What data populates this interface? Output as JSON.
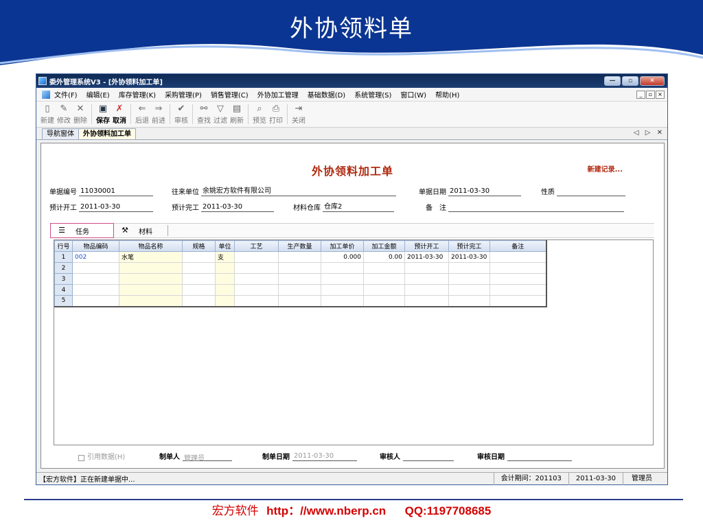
{
  "slide": {
    "title": "外协领料单",
    "footer_brand": "宏方软件",
    "footer_url": "http：//www.nberp.cn",
    "footer_qq": "QQ:1197708685",
    "colors": {
      "header_blue": "#0a2f86",
      "footer_red": "#d40000"
    }
  },
  "window": {
    "title": "委外管理系统V3 - [外协领料加工单]",
    "buttons": {
      "minimize": "—",
      "restore": "▫",
      "close": "✕"
    }
  },
  "menu": {
    "items": [
      "文件(F)",
      "编辑(E)",
      "库存管理(K)",
      "采购管理(P)",
      "销售管理(C)",
      "外协加工管理",
      "基础数据(D)",
      "系统管理(S)",
      "窗口(W)",
      "帮助(H)"
    ],
    "mdi_buttons": [
      "_",
      "▫",
      "×"
    ]
  },
  "toolbar": {
    "new": "新建",
    "edit": "修改",
    "delete": "删除",
    "save": "保存",
    "cancel": "取消",
    "back": "后退",
    "forward": "前进",
    "audit": "审核",
    "find": "查找",
    "filter": "过滤",
    "refresh": "刷新",
    "preview": "预览",
    "print": "打印",
    "close": "关闭"
  },
  "tabs": {
    "nav": "导航窗体",
    "active": "外协领料加工单",
    "nav_arrows": "◁ ▷ ✕"
  },
  "form": {
    "title": "外协领料加工单",
    "status": "新建记录...",
    "bill_no_label": "单据编号",
    "bill_no": "11030001",
    "partner_label": "往来单位",
    "partner": "余姚宏方软件有限公司",
    "bill_date_label": "单据日期",
    "bill_date": "2011-03-30",
    "nature_label": "性质",
    "nature": "",
    "plan_start_label": "预计开工",
    "plan_start": "2011-03-30",
    "plan_end_label": "预计完工",
    "plan_end": "2011-03-30",
    "warehouse_label": "材料仓库",
    "warehouse": "仓库2",
    "note_label": "备　注",
    "note": ""
  },
  "sub_tabs": {
    "task": "任务",
    "material": "材料"
  },
  "grid": {
    "headers": [
      "行号",
      "物品编码",
      "物品名称",
      "规格",
      "单位",
      "工艺",
      "生产数量",
      "加工单价",
      "加工金额",
      "预计开工",
      "预计完工",
      "备注"
    ],
    "rows": [
      [
        "1",
        "002",
        "水笔",
        "",
        "支",
        "",
        "",
        "0.000",
        "0.00",
        "2011-03-30",
        "2011-03-30",
        ""
      ],
      [
        "2",
        "",
        "",
        "",
        "",
        "",
        "",
        "",
        "",
        "",
        "",
        ""
      ],
      [
        "3",
        "",
        "",
        "",
        "",
        "",
        "",
        "",
        "",
        "",
        "",
        ""
      ],
      [
        "4",
        "",
        "",
        "",
        "",
        "",
        "",
        "",
        "",
        "",
        "",
        ""
      ],
      [
        "5",
        "",
        "",
        "",
        "",
        "",
        "",
        "",
        "",
        "",
        "",
        ""
      ]
    ]
  },
  "footer": {
    "ref_data": "引用数据(H)",
    "maker_label": "制单人",
    "maker": "管理员",
    "make_date_label": "制单日期",
    "make_date": "2011-03-30",
    "auditor_label": "审核人",
    "auditor": "",
    "audit_date_label": "审核日期",
    "audit_date": ""
  },
  "status_bar": {
    "message": "【宏方软件】正在新建单据中...",
    "period": "会计期间：201103",
    "date": "2011-03-30",
    "user": "管理员"
  }
}
